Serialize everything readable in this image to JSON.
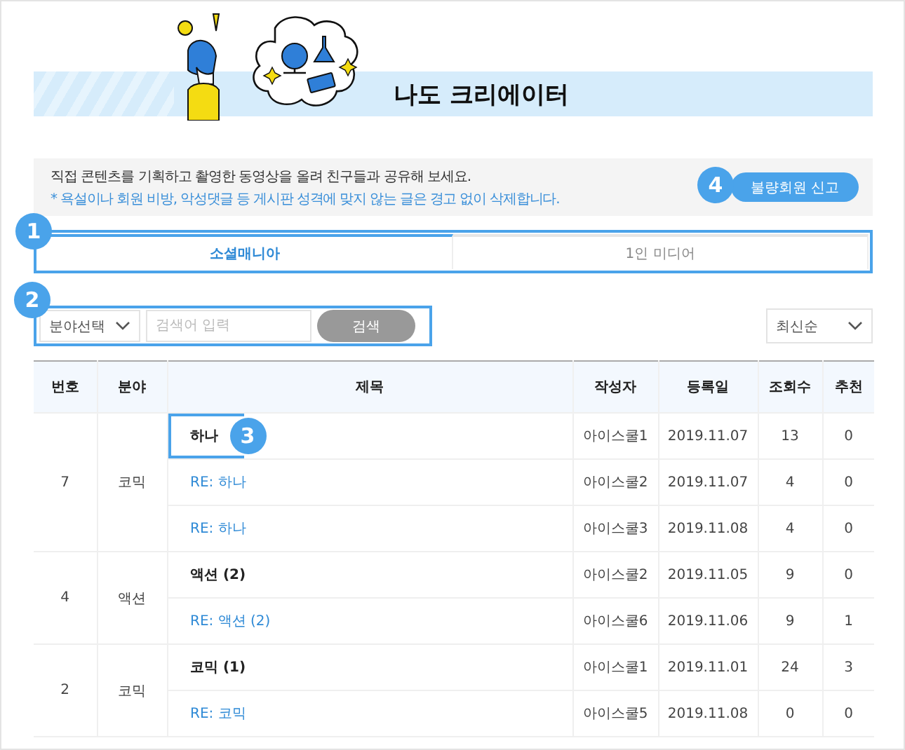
{
  "banner": {
    "title": "나도 크리에이터"
  },
  "notice": {
    "text": "직접 콘텐츠를 기획하고 촬영한 동영상을 올려 친구들과 공유해 보세요.",
    "warning": "* 욕설이나 회원 비방, 악성댓글 등 게시판 성격에 맞지 않는 글은 경고 없이 삭제합니다.",
    "button": "불량회원 신고",
    "callout": "4"
  },
  "tabs": {
    "callout": "1",
    "items": [
      {
        "label": "소셜매니아",
        "selected": true
      },
      {
        "label": "1인 미디어",
        "selected": false
      }
    ]
  },
  "search": {
    "callout": "2",
    "category": "분야선택",
    "placeholder": "검색어 입력",
    "button": "검색",
    "sort": "최신순"
  },
  "table": {
    "columns": [
      "번호",
      "분야",
      "제목",
      "작성자",
      "등록일",
      "조회수",
      "추천"
    ],
    "groups": [
      {
        "number": "7",
        "category": "코믹",
        "posts": [
          {
            "title": "하나",
            "reply": false,
            "highlighted": true,
            "callout": "3",
            "author": "아이스쿨1",
            "date": "2019.11.07",
            "views": "13",
            "likes": "0"
          },
          {
            "title": "RE: 하나",
            "reply": true,
            "highlighted": false,
            "author": "아이스쿨2",
            "date": "2019.11.07",
            "views": "4",
            "likes": "0"
          },
          {
            "title": "RE: 하나",
            "reply": true,
            "highlighted": false,
            "author": "아이스쿨3",
            "date": "2019.11.08",
            "views": "4",
            "likes": "0"
          }
        ]
      },
      {
        "number": "4",
        "category": "액션",
        "posts": [
          {
            "title": "액션 (2)",
            "reply": false,
            "highlighted": false,
            "author": "아이스쿨2",
            "date": "2019.11.05",
            "views": "9",
            "likes": "0"
          },
          {
            "title": "RE: 액션 (2)",
            "reply": true,
            "highlighted": false,
            "author": "아이스쿨6",
            "date": "2019.11.06",
            "views": "9",
            "likes": "1"
          }
        ]
      },
      {
        "number": "2",
        "category": "코믹",
        "posts": [
          {
            "title": "코믹 (1)",
            "reply": false,
            "highlighted": false,
            "author": "아이스쿨1",
            "date": "2019.11.01",
            "views": "24",
            "likes": "3"
          },
          {
            "title": "RE: 코믹",
            "reply": true,
            "highlighted": false,
            "author": "아이스쿨5",
            "date": "2019.11.08",
            "views": "0",
            "likes": "0"
          }
        ]
      }
    ]
  }
}
